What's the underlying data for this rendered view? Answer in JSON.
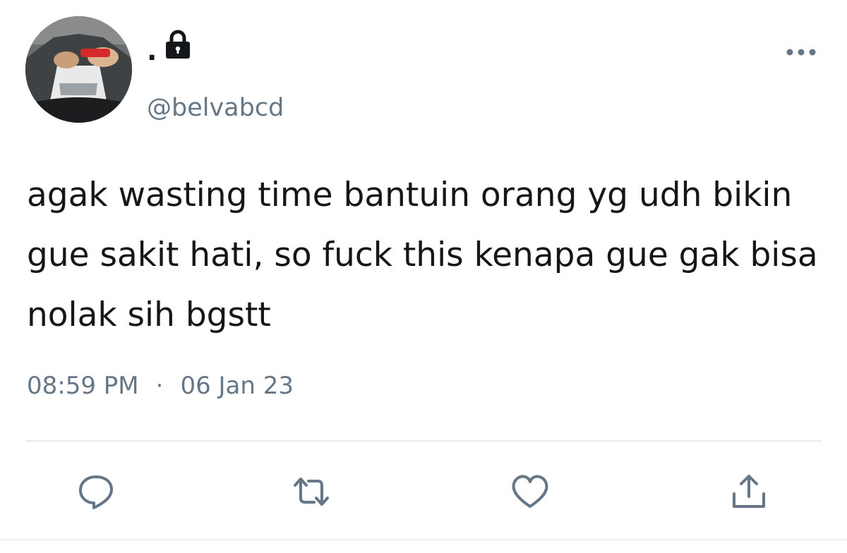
{
  "tweet": {
    "display_name": ".",
    "handle": "@belvabcd",
    "text": "agak wasting time bantuin orang yg udh bikin gue sakit hati, so fuck this kenapa gue gak bisa nolak sih bgstt",
    "time": "08:59 PM",
    "separator": "·",
    "date": "06 Jan 23",
    "protected": true
  },
  "icons": {
    "avatar": "avatar",
    "lock": "lock-icon",
    "more": "more-icon",
    "reply": "reply-icon",
    "retweet": "retweet-icon",
    "like": "heart-icon",
    "share": "share-icon"
  },
  "colors": {
    "text": "#14171a",
    "muted": "#657786",
    "icon": "#657786",
    "divider": "#e6ecf0"
  }
}
